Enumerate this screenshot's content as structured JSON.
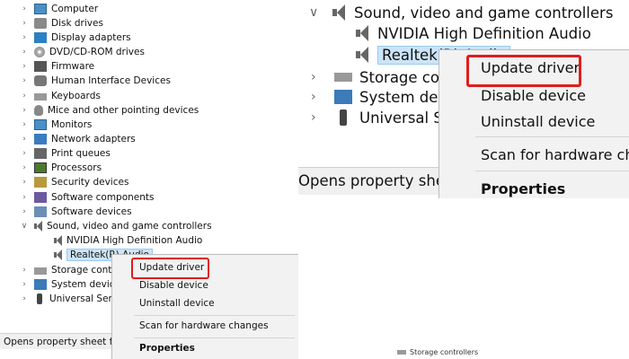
{
  "left_panel": {
    "tree": [
      {
        "label": "Computer",
        "icon": "monitor-icon",
        "expanded": false
      },
      {
        "label": "Disk drives",
        "icon": "disk-drive-icon",
        "expanded": false
      },
      {
        "label": "Display adapters",
        "icon": "display-adapter-icon",
        "expanded": false
      },
      {
        "label": "DVD/CD-ROM drives",
        "icon": "dvd-icon",
        "expanded": false
      },
      {
        "label": "Firmware",
        "icon": "firmware-icon",
        "expanded": false
      },
      {
        "label": "Human Interface Devices",
        "icon": "hid-icon",
        "expanded": false
      },
      {
        "label": "Keyboards",
        "icon": "keyboard-icon",
        "expanded": false
      },
      {
        "label": "Mice and other pointing devices",
        "icon": "mouse-icon",
        "expanded": false
      },
      {
        "label": "Monitors",
        "icon": "monitor-icon",
        "expanded": false
      },
      {
        "label": "Network adapters",
        "icon": "network-adapter-icon",
        "expanded": false
      },
      {
        "label": "Print queues",
        "icon": "printer-icon",
        "expanded": false
      },
      {
        "label": "Processors",
        "icon": "processor-icon",
        "expanded": false
      },
      {
        "label": "Security devices",
        "icon": "security-icon",
        "expanded": false
      },
      {
        "label": "Software components",
        "icon": "software-component-icon",
        "expanded": false
      },
      {
        "label": "Software devices",
        "icon": "software-device-icon",
        "expanded": false
      },
      {
        "label": "Sound, video and game controllers",
        "icon": "speaker-icon",
        "expanded": true
      },
      {
        "label": "NVIDIA High Definition Audio",
        "icon": "speaker-icon",
        "child": true
      },
      {
        "label": "Realtek(R) Audio",
        "icon": "speaker-icon",
        "child": true,
        "selected": true
      },
      {
        "label": "Storage controllers",
        "icon": "storage-icon",
        "expanded": false
      },
      {
        "label": "System devices",
        "icon": "system-icon",
        "expanded": false
      },
      {
        "label": "Universal Serial Bus controllers",
        "icon": "usb-icon",
        "expanded": false
      }
    ],
    "status_text": "Opens property sheet for the current selection.",
    "menu": {
      "update_driver": "Update driver",
      "disable_device": "Disable device",
      "uninstall_device": "Uninstall device",
      "scan": "Scan for hardware changes",
      "properties": "Properties"
    }
  },
  "right_panel": {
    "tree": [
      {
        "label": "Sound, video and game controllers",
        "expanded": true
      },
      {
        "label": "NVIDIA High Definition Audio",
        "child": true
      },
      {
        "label": "Realtek(R) Audio",
        "child": true,
        "selected": true
      },
      {
        "label": "Storage controllers"
      },
      {
        "label": "System devices"
      },
      {
        "label": "Universal Serial Bus controllers"
      }
    ],
    "status_text": "Opens property sheet for the current selection.",
    "menu": {
      "update_driver": "Update driver",
      "disable_device": "Disable device",
      "uninstall_device": "Uninstall device",
      "scan": "Scan for hardware changes",
      "properties": "Properties"
    }
  },
  "bottom_strip": {
    "label": "Storage controllers"
  },
  "highlight_color": "#e11d1d"
}
